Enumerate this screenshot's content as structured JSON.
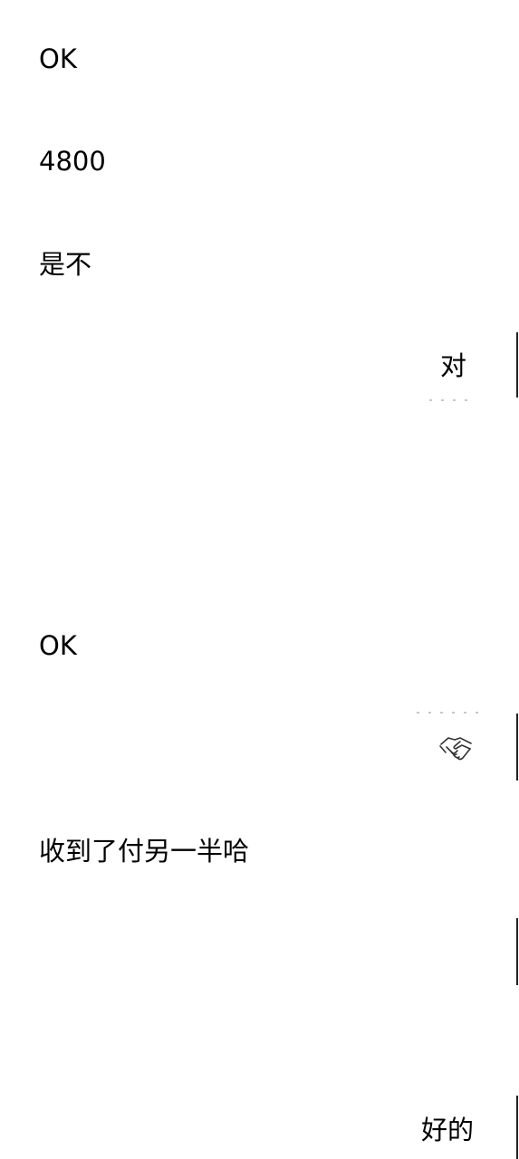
{
  "chat": {
    "messages": [
      {
        "side": "incoming",
        "text": "OK"
      },
      {
        "side": "incoming",
        "text": "4800"
      },
      {
        "side": "incoming",
        "text": "是不"
      },
      {
        "side": "outgoing",
        "text": "对"
      },
      {
        "side": "incoming",
        "text": "OK"
      },
      {
        "side": "outgoing",
        "icon": "handshake-icon"
      },
      {
        "side": "incoming",
        "text": "收到了付另一半哈"
      },
      {
        "side": "outgoing",
        "text": "好的"
      }
    ]
  }
}
